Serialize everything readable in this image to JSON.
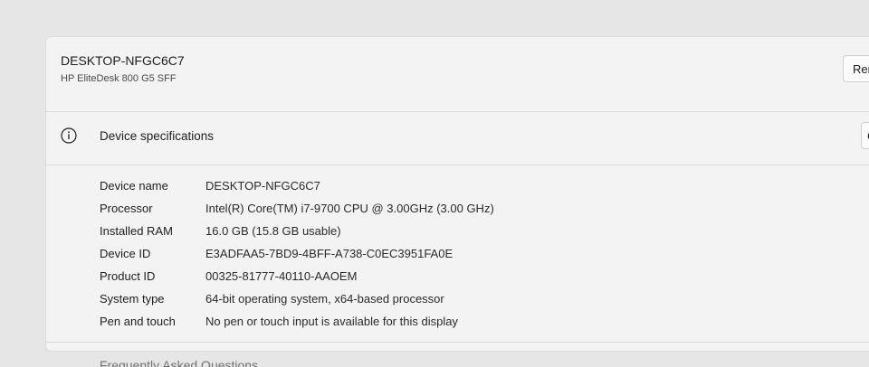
{
  "device": {
    "name": "DESKTOP-NFGC6C7",
    "model": "HP EliteDesk 800 G5 SFF",
    "rename_label": "Rena"
  },
  "specs": {
    "title": "Device specifications",
    "copy_label": "C",
    "rows": [
      {
        "label": "Device name",
        "value": "DESKTOP-NFGC6C7"
      },
      {
        "label": "Processor",
        "value": "Intel(R) Core(TM) i7-9700 CPU @ 3.00GHz (3.00 GHz)"
      },
      {
        "label": "Installed RAM",
        "value": "16.0 GB (15.8 GB usable)"
      },
      {
        "label": "Device ID",
        "value": "E3ADFAA5-7BD9-4BFF-A738-C0EC3951FA0E"
      },
      {
        "label": "Product ID",
        "value": "00325-81777-40110-AAOEM"
      },
      {
        "label": "System type",
        "value": "64-bit operating system, x64-based processor"
      },
      {
        "label": "Pen and touch",
        "value": "No pen or touch input is available for this display"
      }
    ]
  },
  "faq": {
    "title": "Frequently Asked Questions"
  },
  "icons": {
    "info": "info-icon"
  }
}
